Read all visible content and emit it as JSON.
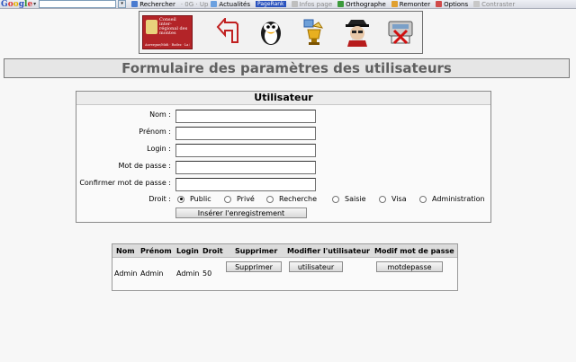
{
  "toolbar": {
    "logo": "Google",
    "items": [
      {
        "label": "Rechercher",
        "icon": "search-icon"
      },
      {
        "label": "Actualités",
        "icon": "news-icon"
      },
      {
        "label": "Infos page",
        "icon": "page-info-icon"
      },
      {
        "label": "Orthographe",
        "icon": "spellcheck-icon"
      },
      {
        "label": "Remonter",
        "icon": "up-icon"
      },
      {
        "label": "Options",
        "icon": "options-icon"
      },
      {
        "label": "Contraster",
        "icon": "contrast-icon"
      }
    ],
    "badge": "PageRank"
  },
  "header": {
    "logo": {
      "title": "Conseil inter-régional des montes",
      "caption": "Auvergne/Midi · Rodez · La Salvetat"
    },
    "icons": [
      "back-arrow-icon",
      "penguin-icon",
      "trophy-icon",
      "detective-icon",
      "delete-disk-icon"
    ]
  },
  "page": {
    "title": "Formulaire des paramètres des utilisateurs"
  },
  "form": {
    "heading": "Utilisateur",
    "fields": [
      {
        "label": "Nom :",
        "value": ""
      },
      {
        "label": "Prénom :",
        "value": ""
      },
      {
        "label": "Login :",
        "value": ""
      },
      {
        "label": "Mot de passe :",
        "value": ""
      },
      {
        "label": "Confirmer mot de passe :",
        "value": ""
      }
    ],
    "droit_label": "Droit :",
    "droit_options": [
      "Public",
      "Privé",
      "Recherche",
      "Saisie",
      "Visa",
      "Administration"
    ],
    "droit_selected": "Public",
    "submit_label": "Insérer l'enregistrement"
  },
  "table": {
    "headers": [
      "Nom",
      "Prénom",
      "Login",
      "Droit",
      "Supprimer",
      "Modifier l'utilisateur",
      "Modif mot de passe"
    ],
    "rows": [
      {
        "nom": "Admin",
        "prenom": "Admin",
        "login": "Admin",
        "droit": "50",
        "delete_label": "Supprimer",
        "edit_label": "utilisateur",
        "pwd_label": "motdepasse"
      }
    ]
  },
  "colors": {
    "logo_red": "#b32428",
    "title_text": "#5f5f5f",
    "panel_border": "#8a8a8a"
  }
}
